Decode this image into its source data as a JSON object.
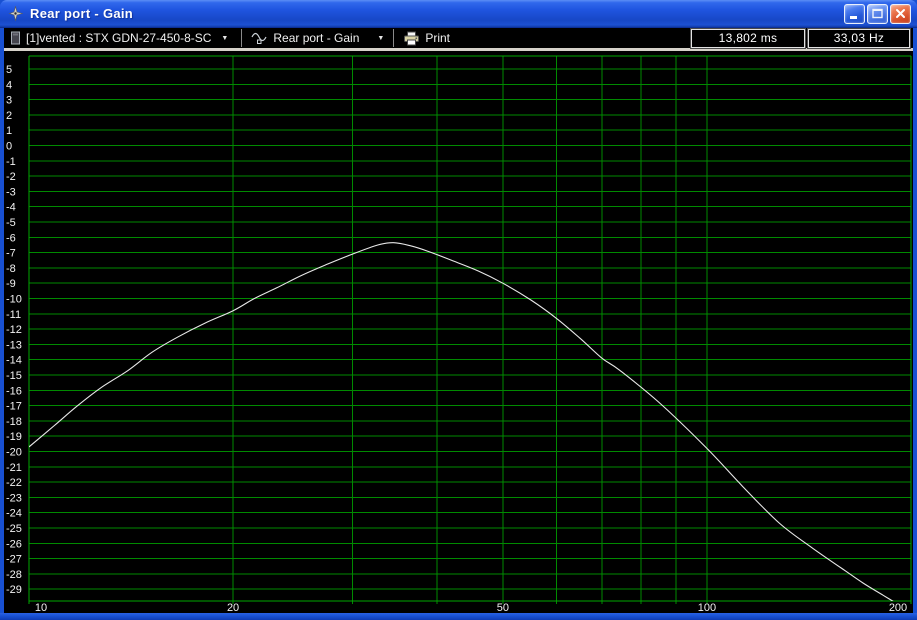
{
  "window": {
    "title": "Rear port - Gain",
    "buttons": {
      "minimize": "Minimize",
      "maximize": "Maximize",
      "close": "Close"
    }
  },
  "toolbar": {
    "config_selector": {
      "label": "[1]vented : STX GDN-27-450-8-SC"
    },
    "graph_selector": {
      "label": "Rear port - Gain"
    },
    "print_button": {
      "label": "Print"
    },
    "readouts": [
      {
        "name": "cursor-time",
        "value": "13,802 ms"
      },
      {
        "name": "cursor-frequency",
        "value": "33,03 Hz"
      }
    ]
  },
  "chart_data": {
    "type": "line",
    "title": "Rear port - Gain",
    "x_scale": "log",
    "x_min": 10,
    "x_max": 200,
    "y_min": -29,
    "y_max": 5,
    "y_step": 1,
    "x_tick_labels": [
      10,
      20,
      50,
      100,
      200
    ],
    "x_gridlines": [
      20,
      30,
      40,
      50,
      60,
      70,
      80,
      90,
      100
    ],
    "grid": true,
    "legend": false,
    "xlabel": "",
    "ylabel": "",
    "colors": {
      "background": "#000000",
      "grid": "#008a00",
      "frame": "#00a800",
      "curve": "#e8e8e8",
      "tick_text": "#f2f2f2"
    },
    "series": [
      {
        "name": "Rear port - Gain",
        "points": [
          [
            10,
            -19.7
          ],
          [
            10.9,
            -18.3
          ],
          [
            11.8,
            -17.0
          ],
          [
            12.8,
            -15.8
          ],
          [
            14,
            -14.7
          ],
          [
            15.2,
            -13.5
          ],
          [
            16.6,
            -12.5
          ],
          [
            18.2,
            -11.6
          ],
          [
            20,
            -10.8
          ],
          [
            21.5,
            -10.0
          ],
          [
            23.2,
            -9.3
          ],
          [
            25.2,
            -8.5
          ],
          [
            27.4,
            -7.8
          ],
          [
            30,
            -7.1
          ],
          [
            32.7,
            -6.5
          ],
          [
            34.5,
            -6.35
          ],
          [
            36.5,
            -6.55
          ],
          [
            38.7,
            -6.9
          ],
          [
            42,
            -7.5
          ],
          [
            46,
            -8.2
          ],
          [
            50,
            -9.0
          ],
          [
            55,
            -10.1
          ],
          [
            60,
            -11.3
          ],
          [
            65,
            -12.6
          ],
          [
            70,
            -13.9
          ],
          [
            74.4,
            -14.7
          ],
          [
            85,
            -16.8
          ],
          [
            100,
            -19.8
          ],
          [
            113,
            -22.3
          ],
          [
            128,
            -24.7
          ],
          [
            143,
            -26.3
          ],
          [
            160,
            -27.8
          ],
          [
            170,
            -28.6
          ],
          [
            182,
            -29.4
          ],
          [
            190,
            -29.9
          ]
        ]
      }
    ]
  }
}
